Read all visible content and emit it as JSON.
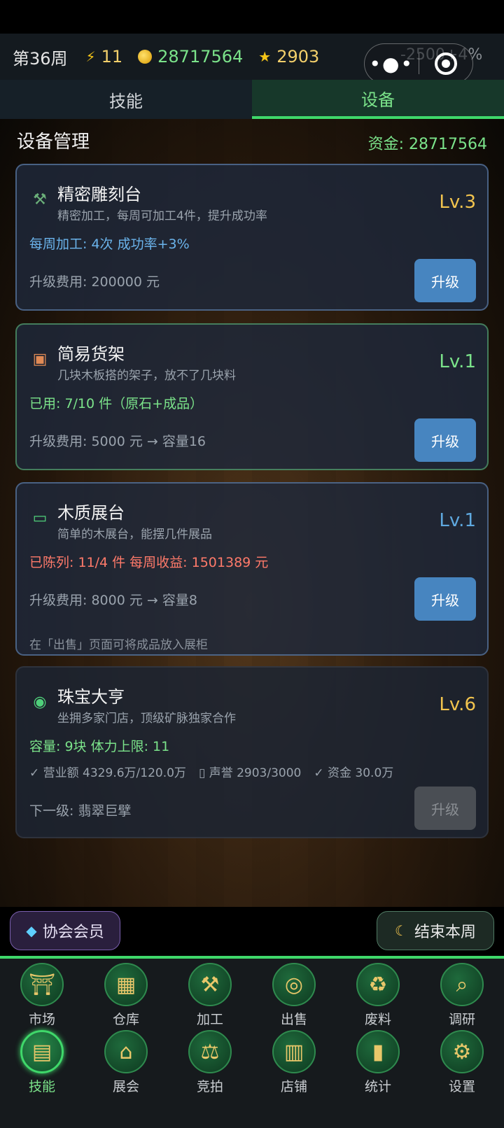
{
  "status": {
    "week": "第36周",
    "energy": "11",
    "money": "28717564",
    "reputation": "2903",
    "faded_text": "-2500+4%"
  },
  "tabs": [
    {
      "label": "技能"
    },
    {
      "label": "设备"
    }
  ],
  "section": {
    "title": "设备管理",
    "funds": "资金: 28717564"
  },
  "cards": [
    {
      "icon": "hammer-icon",
      "name": "精密雕刻台",
      "desc": "精密加工，每周可加工4件，提升成功率",
      "level": "Lv.3",
      "stat": "每周加工: 4次   成功率+3%",
      "cost": "升级费用: 200000 元",
      "button": "升级"
    },
    {
      "icon": "box-icon",
      "name": "简易货架",
      "desc": "几块木板搭的架子，放不了几块料",
      "level": "Lv.1",
      "stat": "已用: 7/10 件（原石+成品）",
      "cost": "升级费用: 5000 元 → 容量16",
      "button": "升级"
    },
    {
      "icon": "display-case-icon",
      "name": "木质展台",
      "desc": "简单的木展台，能摆几件展品",
      "level": "Lv.1",
      "stat": "已陈列: 11/4 件   每周收益: 1501389 元",
      "cost": "升级费用: 8000 元 → 容量8",
      "button": "升级",
      "note": "在「出售」页面可将成品放入展柜"
    },
    {
      "icon": "shop-badge-icon",
      "name": "珠宝大亨",
      "desc": "坐拥多家门店，顶级矿脉独家合作",
      "level": "Lv.6",
      "stat": "容量: 9块   体力上限: 11",
      "requirements": [
        "✓ 营业额 4329.6万/120.0万",
        "▯ 声誉 2903/3000",
        "✓ 资金 30.0万"
      ],
      "cost": "下一级: 翡翠巨擘",
      "button": "升级"
    }
  ],
  "actions": {
    "member": "协会会员",
    "end_week": "结束本周"
  },
  "nav": [
    {
      "label": "市场",
      "icon": "market-gate-icon",
      "glyph": "⛩"
    },
    {
      "label": "仓库",
      "icon": "warehouse-icon",
      "glyph": "▦"
    },
    {
      "label": "加工",
      "icon": "tools-icon",
      "glyph": "⚒"
    },
    {
      "label": "出售",
      "icon": "coin-icon",
      "glyph": "◎"
    },
    {
      "label": "废料",
      "icon": "recycle-icon",
      "glyph": "♻"
    },
    {
      "label": "调研",
      "icon": "magnifier-icon",
      "glyph": "⌕"
    },
    {
      "label": "技能",
      "icon": "book-icon",
      "glyph": "▤"
    },
    {
      "label": "展会",
      "icon": "museum-icon",
      "glyph": "⌂"
    },
    {
      "label": "竞拍",
      "icon": "gavel-icon",
      "glyph": "⚖"
    },
    {
      "label": "店铺",
      "icon": "shop-icon",
      "glyph": "▥"
    },
    {
      "label": "统计",
      "icon": "bar-chart-icon",
      "glyph": "▮"
    },
    {
      "label": "设置",
      "icon": "gear-icon",
      "glyph": "⚙"
    }
  ]
}
